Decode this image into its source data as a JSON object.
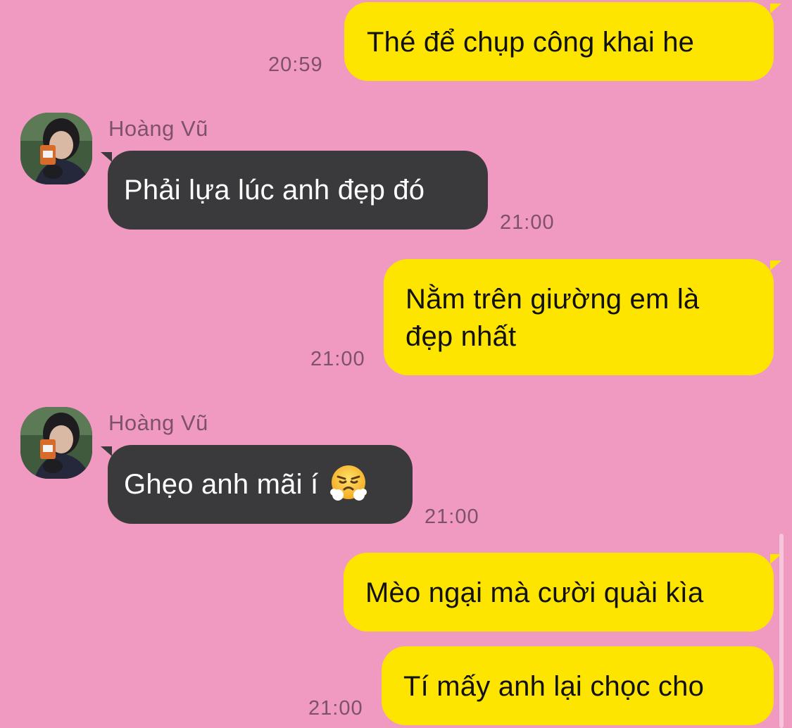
{
  "messages": [
    {
      "id": "m1",
      "direction": "outgoing",
      "text": "Thé để chụp công khai he",
      "time": "20:59"
    },
    {
      "id": "m2",
      "direction": "incoming",
      "sender": "Hoàng Vũ",
      "text": "Phải lựa lúc anh đẹp đó",
      "time": "21:00"
    },
    {
      "id": "m3",
      "direction": "outgoing",
      "text_line1": "Nằm trên giường em là",
      "text_line2": "đẹp nhất",
      "time": "21:00"
    },
    {
      "id": "m4",
      "direction": "incoming",
      "sender": "Hoàng Vũ",
      "text": "Ghẹo anh mãi í",
      "emoji": "huffing-face-emoji",
      "time": "21:00"
    },
    {
      "id": "m5",
      "direction": "outgoing",
      "text": "Mèo ngại mà cười quài kìa"
    },
    {
      "id": "m6",
      "direction": "outgoing",
      "text": "Tí mấy anh lại chọc cho",
      "time": "21:00"
    }
  ],
  "colors": {
    "background": "#f19ac1",
    "outgoing_bubble": "#fee500",
    "incoming_bubble": "#3a3a3c",
    "timestamp": "#7d5268"
  }
}
